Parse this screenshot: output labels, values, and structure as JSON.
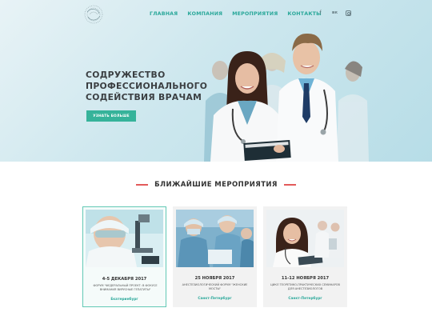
{
  "nav": {
    "items": [
      {
        "label": "ГЛАВНАЯ"
      },
      {
        "label": "КОМПАНИЯ"
      },
      {
        "label": "МЕРОПРИЯТИЯ"
      },
      {
        "label": "КОНТАКТЫ"
      }
    ]
  },
  "social": {
    "facebook": "f",
    "vk": "вк",
    "instagram_icon": "instagram-icon"
  },
  "hero": {
    "title_line1": "СОДРУЖЕСТВО",
    "title_line2": "ПРОФЕССИОНАЛЬНОГО",
    "title_line3": "СОДЕЙСТВИЯ ВРАЧАМ",
    "button_label": "УЗНАТЬ БОЛЬШЕ"
  },
  "events": {
    "section_title": "БЛИЖАЙШИЕ МЕРОПРИЯТИЯ",
    "items": [
      {
        "date": "4-5 ДЕКАБРЯ 2017",
        "description": "ФОРУМ \"ФЕДЕРАЛЬНЫЙ ПРОЕКТ: В ФОКУСЕ ВНИМАНИЯ ВИРУСНЫЕ ГЕПАТИТЫ\"",
        "city": "Екатеринбург"
      },
      {
        "date": "25 НОЯБРЯ 2017",
        "description": "АНЕСТЕЗИОЛОГИЧЕСКИЙ ФОРУМ \"ЖЕНСКИЕ МОСТЫ\"",
        "city": "Санкт-Петербург"
      },
      {
        "date": "11-12 НОЯБРЯ 2017",
        "description": "ЦИКЛ ТЕОРЕТИКО-ПРАКТИЧЕСКИХ СЕМИНАРОВ ДЛЯ АНЕСТЕЗИОЛОГОВ",
        "city": "Санкт-Петербург"
      }
    ]
  },
  "colors": {
    "accent": "#36b39a",
    "nav_text": "#2aa89a",
    "section_line": "#e35a5a"
  }
}
